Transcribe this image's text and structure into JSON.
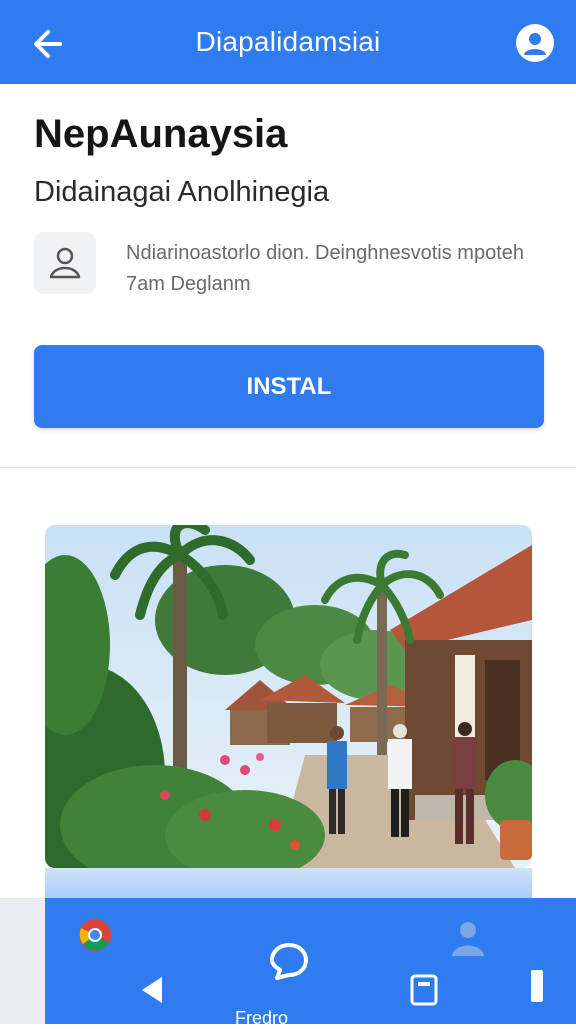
{
  "header": {
    "title": "Diapalidamsiai",
    "back_icon": "arrow-left-icon",
    "profile_icon": "user-icon"
  },
  "app": {
    "name": "NepAunaysia",
    "subtitle": "Didainagai Anolhinegia",
    "developer_text": "Ndiarinoastorlo dion. Deinghnesvotis mpoteh 7am Deglanm",
    "install_label": "INSTAL"
  },
  "bottom_nav": {
    "active_label": "Fredro"
  },
  "colors": {
    "accent": "#2f7cf0",
    "title_text": "#151515",
    "muted_text": "#6a6a6a"
  },
  "icons": [
    "arrow-left-icon",
    "user-icon",
    "developer-icon",
    "chrome-icon",
    "chat-bubble-icon",
    "person-icon",
    "back-triangle-icon",
    "home-square-icon",
    "recents-icon"
  ]
}
